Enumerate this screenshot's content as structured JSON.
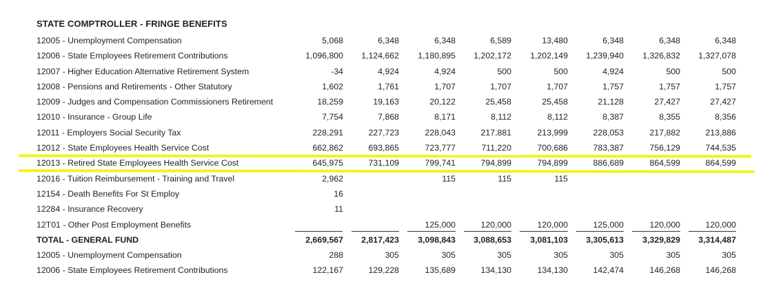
{
  "title": "STATE COMPTROLLER - FRINGE BENEFITS",
  "highlight_color": "#f5f21a",
  "rows": [
    {
      "label": "12005 - Unemployment Compensation",
      "values": [
        "5,068",
        "6,348",
        "6,348",
        "6,589",
        "13,480",
        "6,348",
        "6,348",
        "6,348"
      ]
    },
    {
      "label": "12006 - State Employees Retirement Contributions",
      "values": [
        "1,096,800",
        "1,124,662",
        "1,180,895",
        "1,202,172",
        "1,202,149",
        "1,239,940",
        "1,326,832",
        "1,327,078"
      ]
    },
    {
      "label": "12007 - Higher Education Alternative Retirement System",
      "values": [
        "-34",
        "4,924",
        "4,924",
        "500",
        "500",
        "4,924",
        "500",
        "500"
      ]
    },
    {
      "label": "12008 - Pensions and Retirements - Other Statutory",
      "values": [
        "1,602",
        "1,761",
        "1,707",
        "1,707",
        "1,707",
        "1,757",
        "1,757",
        "1,757"
      ]
    },
    {
      "label": "12009 - Judges and Compensation Commissioners Retirement",
      "values": [
        "18,259",
        "19,163",
        "20,122",
        "25,458",
        "25,458",
        "21,128",
        "27,427",
        "27,427"
      ]
    },
    {
      "label": "12010 - Insurance - Group Life",
      "values": [
        "7,754",
        "7,868",
        "8,171",
        "8,112",
        "8,112",
        "8,387",
        "8,355",
        "8,356"
      ]
    },
    {
      "label": "12011 - Employers Social Security Tax",
      "values": [
        "228,291",
        "227,723",
        "228,043",
        "217,881",
        "213,999",
        "228,053",
        "217,882",
        "213,886"
      ]
    },
    {
      "label": "12012 - State Employees Health Service Cost",
      "values": [
        "662,862",
        "693,865",
        "723,777",
        "711,220",
        "700,686",
        "783,387",
        "756,129",
        "744,535"
      ]
    },
    {
      "label": "12013 - Retired State Employees Health Service Cost",
      "values": [
        "645,975",
        "731,109",
        "799,741",
        "794,899",
        "794,899",
        "886,689",
        "864,599",
        "864,599"
      ]
    },
    {
      "label": "12016 - Tuition Reimbursement - Training and Travel",
      "values": [
        "2,962",
        "",
        "115",
        "115",
        "115",
        "",
        "",
        ""
      ]
    },
    {
      "label": "12154 - Death Benefits For St Employ",
      "values": [
        "16",
        "",
        "",
        "",
        "",
        "",
        "",
        ""
      ]
    },
    {
      "label": "12284 - Insurance Recovery",
      "values": [
        "11",
        "",
        "",
        "",
        "",
        "",
        "",
        ""
      ]
    },
    {
      "label": "12T01 - Other Post Employment Benefits",
      "values": [
        "",
        "",
        "125,000",
        "120,000",
        "120,000",
        "125,000",
        "120,000",
        "120,000"
      ]
    },
    {
      "label": "TOTAL - GENERAL FUND",
      "values": [
        "2,669,567",
        "2,817,423",
        "3,098,843",
        "3,088,653",
        "3,081,103",
        "3,305,613",
        "3,329,829",
        "3,314,487"
      ]
    },
    {
      "label": "12005 - Unemployment Compensation",
      "values": [
        "288",
        "305",
        "305",
        "305",
        "305",
        "305",
        "305",
        "305"
      ]
    },
    {
      "label": "12006 - State Employees Retirement Contributions",
      "values": [
        "122,167",
        "129,228",
        "135,689",
        "134,130",
        "134,130",
        "142,474",
        "146,268",
        "146,268"
      ]
    }
  ]
}
